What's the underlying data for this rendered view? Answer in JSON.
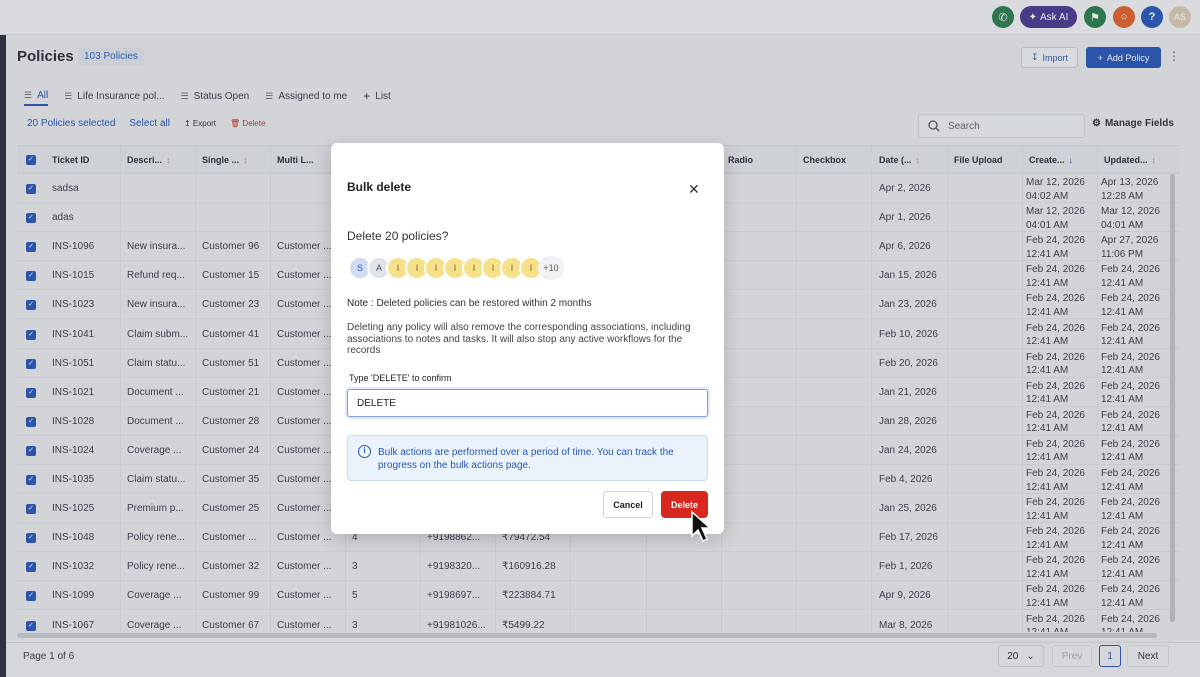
{
  "topbar": {
    "ask_ai": "Ask AI",
    "avatar_initials": "AS",
    "help": "?"
  },
  "page": {
    "title": "Policies",
    "count_badge": "103 Policies",
    "import_label": "Import",
    "add_label": "Add Policy"
  },
  "tabs": [
    {
      "label": "All",
      "icon": "list-icon"
    },
    {
      "label": "Life Insurance pol...",
      "icon": "list-icon"
    },
    {
      "label": "Status Open",
      "icon": "list-icon"
    },
    {
      "label": "Assigned to me",
      "icon": "list-icon"
    },
    {
      "label": "List",
      "icon": "plus-icon"
    }
  ],
  "bulkbar": {
    "selected": "20 Policies selected",
    "select_all": "Select all",
    "export": "Export",
    "delete": "Delete"
  },
  "search": {
    "placeholder": "Search"
  },
  "manage_fields": "Manage Fields",
  "table": {
    "columns": [
      "Ticket ID",
      "Descri...",
      "Single ...",
      "Multi L...",
      "Radio",
      "Checkbox",
      "Date (...",
      "File Upload",
      "Create...",
      "Updated..."
    ],
    "rows": [
      {
        "id": "sadsa",
        "desc": "",
        "single": "",
        "multi": "",
        "num": "",
        "phone": "",
        "amount": "",
        "date": "Apr 2, 2026",
        "created": "Mar 12, 2026",
        "created_t": "04:02 AM",
        "updated": "Apr 13, 2026",
        "updated_t": "12:28 AM"
      },
      {
        "id": "adas",
        "desc": "",
        "single": "",
        "multi": "",
        "num": "",
        "phone": "",
        "amount": "",
        "date": "Apr 1, 2026",
        "created": "Mar 12, 2026",
        "created_t": "04:01 AM",
        "updated": "Mar 12, 2026",
        "updated_t": "04:01 AM"
      },
      {
        "id": "INS-1096",
        "desc": "New insura...",
        "single": "Customer 96",
        "multi": "Customer ...",
        "num": "",
        "phone": "",
        "amount": "",
        "date": "Apr 6, 2026",
        "created": "Feb 24, 2026",
        "created_t": "12:41 AM",
        "updated": "Apr 27, 2026",
        "updated_t": "11:06 PM"
      },
      {
        "id": "INS-1015",
        "desc": "Refund req...",
        "single": "Customer 15",
        "multi": "Customer ...",
        "num": "",
        "phone": "",
        "amount": "",
        "date": "Jan 15, 2026",
        "created": "Feb 24, 2026",
        "created_t": "12:41 AM",
        "updated": "Feb 24, 2026",
        "updated_t": "12:41 AM"
      },
      {
        "id": "INS-1023",
        "desc": "New insura...",
        "single": "Customer 23",
        "multi": "Customer ...",
        "num": "",
        "phone": "",
        "amount": "",
        "date": "Jan 23, 2026",
        "created": "Feb 24, 2026",
        "created_t": "12:41 AM",
        "updated": "Feb 24, 2026",
        "updated_t": "12:41 AM"
      },
      {
        "id": "INS-1041",
        "desc": "Claim subm...",
        "single": "Customer 41",
        "multi": "Customer ...",
        "num": "",
        "phone": "",
        "amount": "",
        "date": "Feb 10, 2026",
        "created": "Feb 24, 2026",
        "created_t": "12:41 AM",
        "updated": "Feb 24, 2026",
        "updated_t": "12:41 AM"
      },
      {
        "id": "INS-1051",
        "desc": "Claim statu...",
        "single": "Customer 51",
        "multi": "Customer ...",
        "num": "",
        "phone": "",
        "amount": "",
        "date": "Feb 20, 2026",
        "created": "Feb 24, 2026",
        "created_t": "12:41 AM",
        "updated": "Feb 24, 2026",
        "updated_t": "12:41 AM"
      },
      {
        "id": "INS-1021",
        "desc": "Document ...",
        "single": "Customer 21",
        "multi": "Customer ...",
        "num": "",
        "phone": "",
        "amount": "",
        "date": "Jan 21, 2026",
        "created": "Feb 24, 2026",
        "created_t": "12:41 AM",
        "updated": "Feb 24, 2026",
        "updated_t": "12:41 AM"
      },
      {
        "id": "INS-1028",
        "desc": "Document ...",
        "single": "Customer 28",
        "multi": "Customer ...",
        "num": "",
        "phone": "",
        "amount": "",
        "date": "Jan 28, 2026",
        "created": "Feb 24, 2026",
        "created_t": "12:41 AM",
        "updated": "Feb 24, 2026",
        "updated_t": "12:41 AM"
      },
      {
        "id": "INS-1024",
        "desc": "Coverage ...",
        "single": "Customer 24",
        "multi": "Customer ...",
        "num": "",
        "phone": "",
        "amount": "",
        "date": "Jan 24, 2026",
        "created": "Feb 24, 2026",
        "created_t": "12:41 AM",
        "updated": "Feb 24, 2026",
        "updated_t": "12:41 AM"
      },
      {
        "id": "INS-1035",
        "desc": "Claim statu...",
        "single": "Customer 35",
        "multi": "Customer ...",
        "num": "",
        "phone": "",
        "amount": "",
        "date": "Feb 4, 2026",
        "created": "Feb 24, 2026",
        "created_t": "12:41 AM",
        "updated": "Feb 24, 2026",
        "updated_t": "12:41 AM"
      },
      {
        "id": "INS-1025",
        "desc": "Premium p...",
        "single": "Customer 25",
        "multi": "Customer ...",
        "num": "",
        "phone": "",
        "amount": "",
        "date": "Jan 25, 2026",
        "created": "Feb 24, 2026",
        "created_t": "12:41 AM",
        "updated": "Feb 24, 2026",
        "updated_t": "12:41 AM"
      },
      {
        "id": "INS-1048",
        "desc": "Policy rene...",
        "single": "Customer ...",
        "multi": "Customer ...",
        "num": "4",
        "phone": "+9198862...",
        "amount": "₹79472.54",
        "date": "Feb 17, 2026",
        "created": "Feb 24, 2026",
        "created_t": "12:41 AM",
        "updated": "Feb 24, 2026",
        "updated_t": "12:41 AM"
      },
      {
        "id": "INS-1032",
        "desc": "Policy rene...",
        "single": "Customer 32",
        "multi": "Customer ...",
        "num": "3",
        "phone": "+9198320...",
        "amount": "₹160916.28",
        "date": "Feb 1, 2026",
        "created": "Feb 24, 2026",
        "created_t": "12:41 AM",
        "updated": "Feb 24, 2026",
        "updated_t": "12:41 AM"
      },
      {
        "id": "INS-1099",
        "desc": "Coverage ...",
        "single": "Customer 99",
        "multi": "Customer ...",
        "num": "5",
        "phone": "+9198697...",
        "amount": "₹223884.71",
        "date": "Apr 9, 2026",
        "created": "Feb 24, 2026",
        "created_t": "12:41 AM",
        "updated": "Feb 24, 2026",
        "updated_t": "12:41 AM"
      },
      {
        "id": "INS-1067",
        "desc": "Coverage ...",
        "single": "Customer 67",
        "multi": "Customer ...",
        "num": "3",
        "phone": "+91981026...",
        "amount": "₹5499.22",
        "date": "Mar 8, 2026",
        "created": "Feb 24, 2026",
        "created_t": "12:41 AM",
        "updated": "Feb 24, 2026",
        "updated_t": "12:41 AM"
      }
    ]
  },
  "footer": {
    "page_info": "Page 1 of 6",
    "page_size": "20",
    "prev": "Prev",
    "current": "1",
    "next": "Next"
  },
  "modal": {
    "title": "Bulk delete",
    "question": "Delete 20 policies?",
    "avatars": [
      "S",
      "A",
      "I",
      "I",
      "I",
      "I",
      "I",
      "I",
      "I",
      "I"
    ],
    "avatars_more": "+10",
    "note_label": "Note :",
    "note_text": "Deleted policies can be restored within 2 months",
    "description": "Deleting any policy will also remove the corresponding associations, including associations to notes and tasks. It will also stop any active workflows for the records",
    "confirm_label": "Type 'DELETE' to confirm",
    "confirm_value": "DELETE",
    "info": "Bulk actions are performed over a period of time. You can track the progress on the bulk actions page.",
    "cancel": "Cancel",
    "delete": "Delete"
  },
  "colors": {
    "accent": "#2a58b8",
    "danger": "#d7281f",
    "avatar_yellow": "#f6e08a",
    "avatar_blue": "#cfdcf3"
  }
}
